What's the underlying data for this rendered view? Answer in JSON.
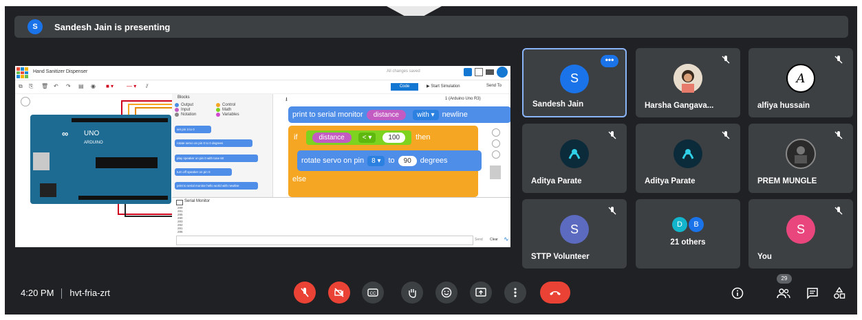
{
  "banner": {
    "avatar_letter": "S",
    "text": "Sandesh Jain is presenting"
  },
  "shared_screen": {
    "project_title": "Hand Sanitizer Dispenser",
    "save_status": "All changes saved",
    "code_button": "Code",
    "start_simulation": "Start Simulation",
    "send_to": "Send To",
    "blocks_label": "Blocks",
    "board_select": "1 (Arduino Uno R3)",
    "board_uno_text": "UNO",
    "board_arduino_text": "ARDUINO",
    "categories": [
      {
        "label": "Output",
        "color": "#4a90e2"
      },
      {
        "label": "Control",
        "color": "#f5a623"
      },
      {
        "label": "Input",
        "color": "#c35bc2"
      },
      {
        "label": "Math",
        "color": "#7ed321"
      },
      {
        "label": "Notation",
        "color": "#888888"
      },
      {
        "label": "Variables",
        "color": "#d04ad0"
      }
    ],
    "mini_blocks": [
      "set pin 3 to 0",
      "rotate servo on pin 0 to 0 degrees",
      "play speaker on pin 0 with tone 60",
      "turn off speaker on pin 0",
      "print to serial monitor hello world with newline"
    ],
    "code_blocks": {
      "print_prefix": "print to serial monitor",
      "print_var": "distance",
      "print_with": "with ▾",
      "print_suffix": "newline",
      "if_label": "if",
      "if_var": "distance",
      "if_op": "< ▾",
      "if_value": "100",
      "then_label": "then",
      "rotate_prefix": "rotate servo on pin",
      "rotate_pin": "8 ▾",
      "to_label": "to",
      "rotate_value": "90",
      "degrees_label": "degrees",
      "else_label": "else"
    },
    "serial_monitor_title": "Serial Monitor",
    "serial_lines": [
      "289",
      "281",
      "285",
      "280",
      "283",
      "282",
      "281",
      "286",
      "280",
      "282"
    ],
    "serial_send": "Send",
    "serial_clear": "Clear"
  },
  "participants": [
    {
      "name": "Sandesh Jain",
      "initial": "S",
      "avatar_color": "#1a73e8",
      "active": true
    },
    {
      "name": "Harsha Gangava...",
      "initial": "",
      "avatar_color": "#f0d3b8",
      "photo": true
    },
    {
      "name": "alfiya hussain",
      "initial": "A",
      "avatar_color": "#ffffff",
      "logo": true
    },
    {
      "name": "Aditya Parate",
      "initial": "",
      "avatar_color": "#0b2a3a",
      "photo": true
    },
    {
      "name": "Aditya Parate",
      "initial": "",
      "avatar_color": "#0b2a3a",
      "photo": true
    },
    {
      "name": "PREM MUNGLE",
      "initial": "",
      "avatar_color": "#2a2a2a",
      "photo": true
    },
    {
      "name": "STTP Volunteer",
      "initial": "S",
      "avatar_color": "#5c6bc0"
    },
    {
      "name": "21 others",
      "initials": [
        "D",
        "B"
      ],
      "colors": [
        "#12b5cb",
        "#1a73e8"
      ]
    },
    {
      "name": "You",
      "initial": "S",
      "avatar_color": "#e8467c"
    }
  ],
  "meeting": {
    "time": "4:20 PM",
    "code": "hvt-fria-zrt",
    "participant_count": "29"
  },
  "colors": {
    "accent": "#1a73e8",
    "danger": "#ea4335",
    "bg": "#202124",
    "tile": "#3c4043"
  }
}
